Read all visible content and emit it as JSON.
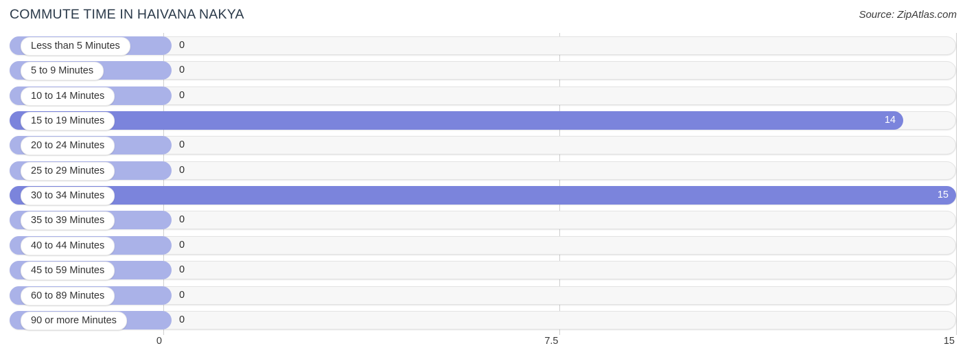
{
  "header": {
    "title": "COMMUTE TIME IN HAIVANA NAKYA",
    "source": "Source: ZipAtlas.com"
  },
  "chart_data": {
    "type": "bar",
    "orientation": "horizontal",
    "title": "COMMUTE TIME IN HAIVANA NAKYA",
    "xlabel": "",
    "ylabel": "",
    "xlim": [
      0,
      15
    ],
    "grid": true,
    "legend": "none",
    "axis_ticks": [
      "0",
      "7.5",
      "15"
    ],
    "axis_tick_values": [
      0,
      7.5,
      15
    ],
    "categories": [
      "Less than 5 Minutes",
      "5 to 9 Minutes",
      "10 to 14 Minutes",
      "15 to 19 Minutes",
      "20 to 24 Minutes",
      "25 to 29 Minutes",
      "30 to 34 Minutes",
      "35 to 39 Minutes",
      "40 to 44 Minutes",
      "45 to 59 Minutes",
      "60 to 89 Minutes",
      "90 or more Minutes"
    ],
    "values": [
      0,
      0,
      0,
      14,
      0,
      0,
      15,
      0,
      0,
      0,
      0,
      0
    ],
    "value_labels": [
      "0",
      "0",
      "0",
      "14",
      "0",
      "0",
      "15",
      "0",
      "0",
      "0",
      "0",
      "0"
    ],
    "colors": {
      "bar_zero": "#aab2e8",
      "bar_filled": "#7b84dc",
      "track": "#f7f7f7",
      "track_border": "#e3e3e3",
      "gridline": "#cfcfcf",
      "label_pill": "#ffffff",
      "title_text": "#2b3a4a",
      "value_text_inside": "#ffffff",
      "value_text_outside": "#2b2b2b"
    }
  }
}
